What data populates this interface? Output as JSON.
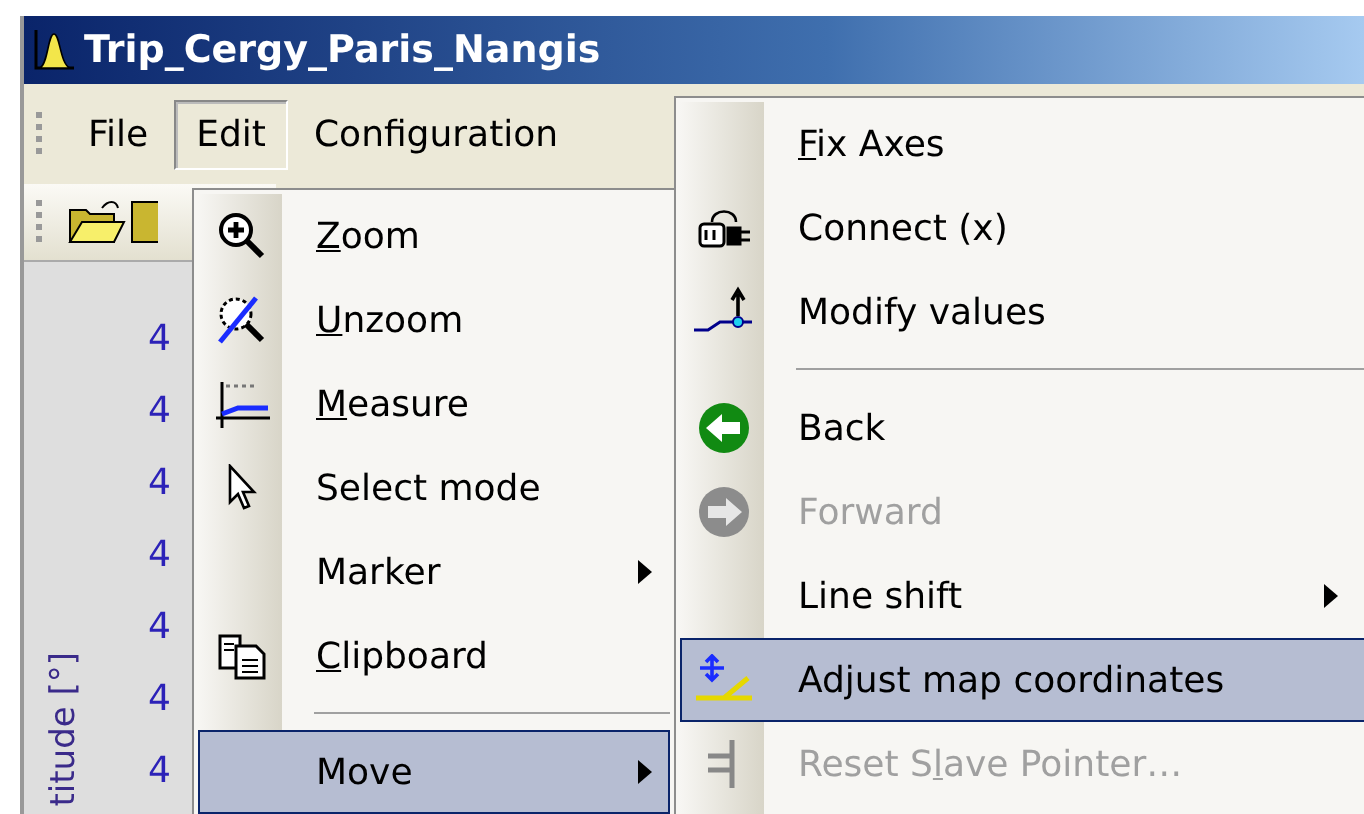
{
  "window": {
    "title": "Trip_Cergy_Paris_Nangis"
  },
  "menubar": [
    {
      "label": "File",
      "selected": false
    },
    {
      "label": "Edit",
      "selected": true
    },
    {
      "label": "Configuration",
      "selected": false
    }
  ],
  "plot": {
    "y_ticks": [
      "4",
      "4",
      "4",
      "4",
      "4",
      "4",
      "4"
    ],
    "y_axis_label": "titude [°]"
  },
  "edit_menu": [
    {
      "kind": "item",
      "key": "Z",
      "post": "oom",
      "disabled": false,
      "selected": false
    },
    {
      "kind": "item",
      "key": "U",
      "post": "nzoom",
      "disabled": false,
      "selected": false
    },
    {
      "kind": "item",
      "key": "M",
      "post": "easure",
      "disabled": false,
      "selected": false
    },
    {
      "kind": "item",
      "pre": "Select mode",
      "disabled": false,
      "selected": false
    },
    {
      "kind": "submenu",
      "pre": "Marker",
      "disabled": false,
      "selected": false
    },
    {
      "kind": "item",
      "key": "C",
      "post": "lipboard",
      "disabled": false,
      "selected": false
    },
    {
      "kind": "separator"
    },
    {
      "kind": "submenu",
      "pre": "Move",
      "disabled": false,
      "selected": true
    }
  ],
  "move_menu": [
    {
      "kind": "item",
      "key": "F",
      "post": "ix Axes",
      "disabled": false,
      "selected": false
    },
    {
      "kind": "item",
      "pre": "Connect (x)",
      "disabled": false,
      "selected": false
    },
    {
      "kind": "item",
      "pre": "Modify values",
      "disabled": false,
      "selected": false
    },
    {
      "kind": "separator"
    },
    {
      "kind": "item",
      "pre": "Back",
      "disabled": false,
      "selected": false
    },
    {
      "kind": "item",
      "pre": "Forward",
      "disabled": true,
      "selected": false
    },
    {
      "kind": "submenu",
      "pre": "Line shift",
      "disabled": false,
      "selected": false
    },
    {
      "kind": "item",
      "pre": "Adjust map coordinates",
      "disabled": false,
      "selected": true
    },
    {
      "kind": "item",
      "pre": "Reset S",
      "key": "l",
      "post": "ave Pointer…",
      "disabled": true,
      "selected": false
    }
  ]
}
